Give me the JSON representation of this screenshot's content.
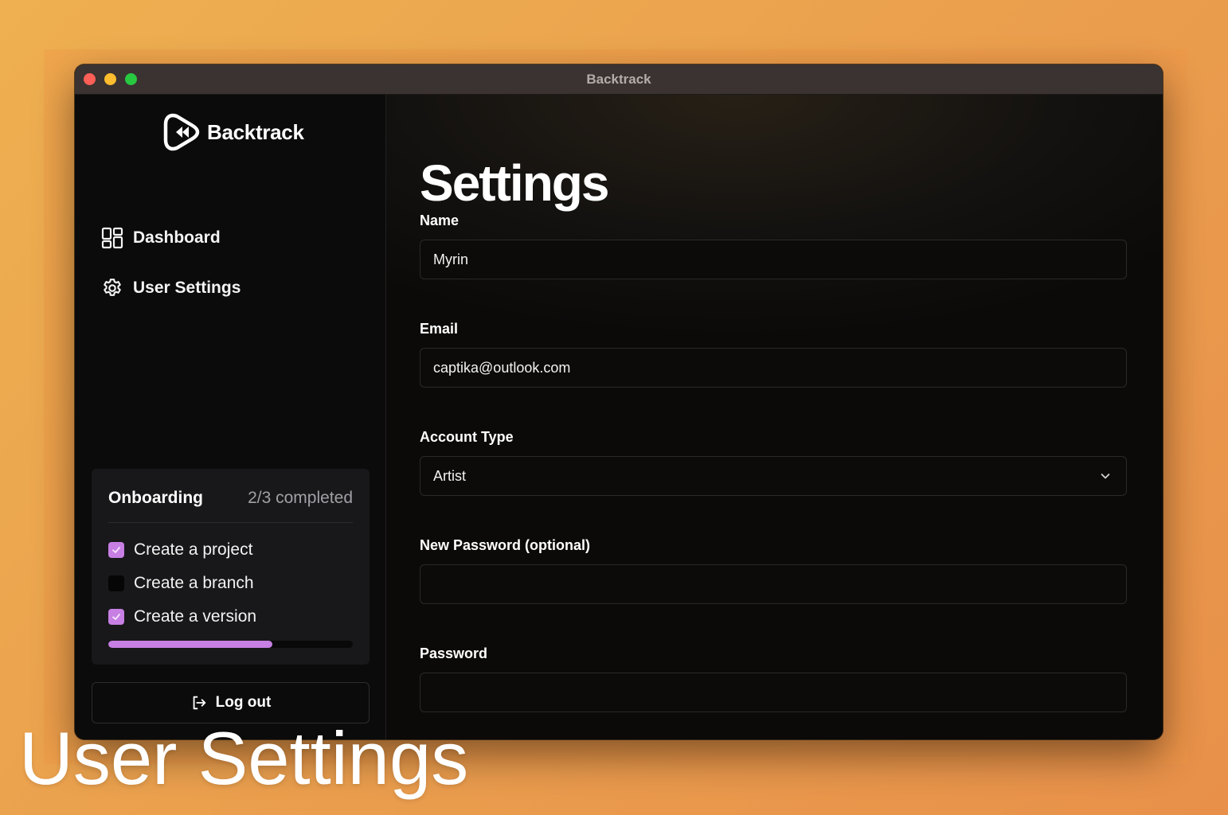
{
  "window": {
    "title": "Backtrack"
  },
  "sidebar": {
    "brand": "Backtrack",
    "nav": [
      {
        "label": "Dashboard",
        "icon": "dashboard-grid-icon"
      },
      {
        "label": "User Settings",
        "icon": "gear-icon"
      }
    ],
    "onboarding": {
      "title": "Onboarding",
      "status": "2/3 completed",
      "tasks": [
        {
          "label": "Create a project",
          "done": true
        },
        {
          "label": "Create a branch",
          "done": false
        },
        {
          "label": "Create a version",
          "done": true
        }
      ],
      "progress": 0.67,
      "accent_color": "#c77fe3"
    },
    "logout_label": "Log out"
  },
  "main": {
    "title": "Settings",
    "fields": {
      "name": {
        "label": "Name",
        "value": "Myrin"
      },
      "email": {
        "label": "Email",
        "value": "captika@outlook.com"
      },
      "account_type": {
        "label": "Account Type",
        "value": "Artist"
      },
      "new_password": {
        "label": "New Password (optional)",
        "value": ""
      },
      "password": {
        "label": "Password",
        "value": ""
      }
    }
  },
  "caption": "User Settings"
}
